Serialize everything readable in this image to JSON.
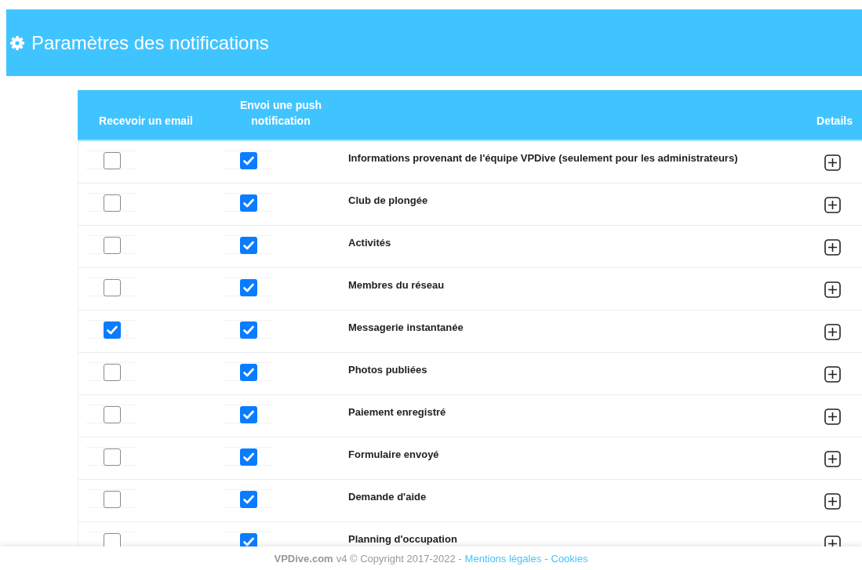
{
  "header": {
    "title": "Paramètres des notifications"
  },
  "table": {
    "columns": [
      "Recevoir un email",
      "Envoi une push notification",
      "Details"
    ],
    "rows": [
      {
        "label": "Informations provenant de l'équipe VPDive (seulement pour les administrateurs)",
        "email": false,
        "push": true
      },
      {
        "label": "Club de plongée",
        "email": false,
        "push": true
      },
      {
        "label": "Activités",
        "email": false,
        "push": true
      },
      {
        "label": "Membres du réseau",
        "email": false,
        "push": true
      },
      {
        "label": "Messagerie instantanée",
        "email": true,
        "push": true
      },
      {
        "label": "Photos publiées",
        "email": false,
        "push": true
      },
      {
        "label": "Paiement enregistré",
        "email": false,
        "push": true
      },
      {
        "label": "Formulaire envoyé",
        "email": false,
        "push": true
      },
      {
        "label": "Demande d'aide",
        "email": false,
        "push": true
      },
      {
        "label": "Planning d'occupation",
        "email": false,
        "push": true
      }
    ]
  },
  "footer": {
    "brand": "VPDive.com",
    "text": "v4 © Copyright 2017-2022 -",
    "links": [
      "Mentions légales",
      "Cookies"
    ],
    "separator": "-"
  }
}
